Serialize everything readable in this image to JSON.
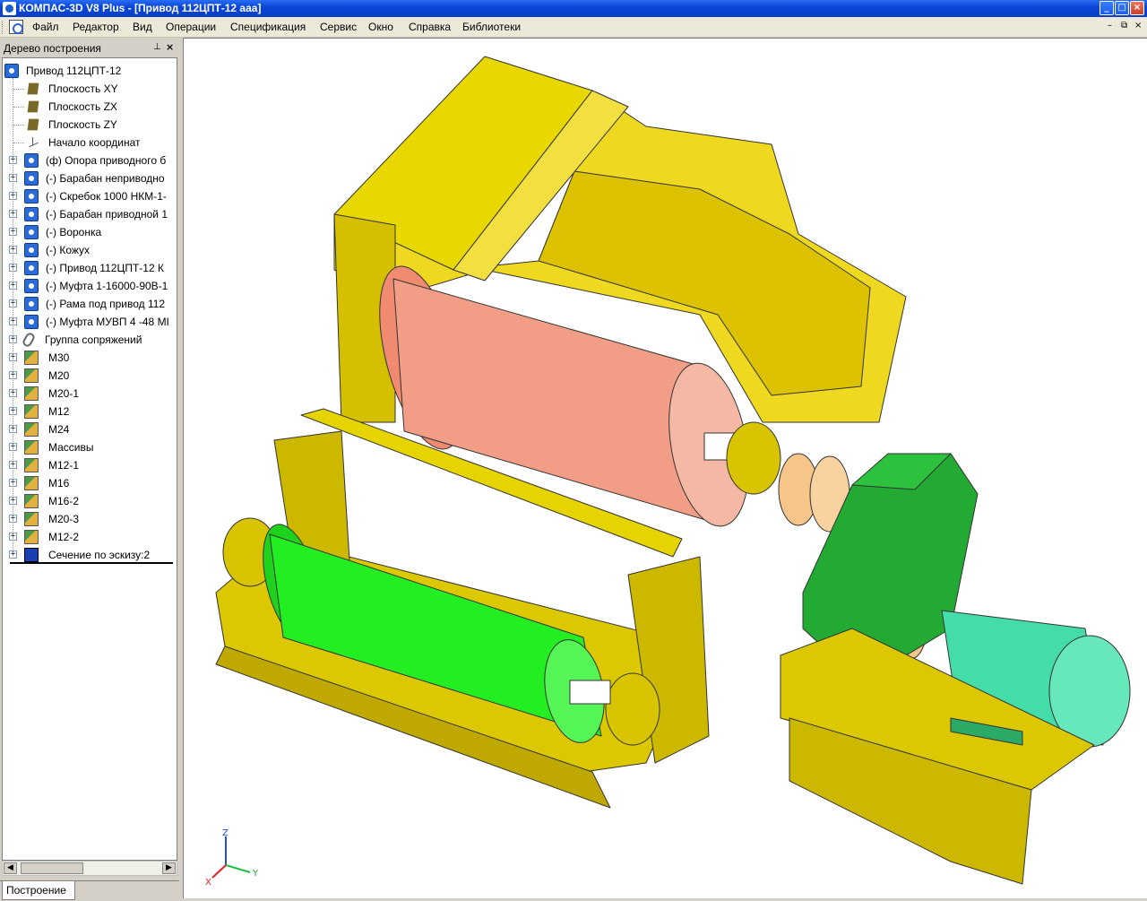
{
  "window": {
    "title": "КОМПАС-3D V8 Plus - [Привод 112ЦПТ-12 ааа]"
  },
  "menu": [
    "Файл",
    "Редактор",
    "Вид",
    "Операции",
    "Спецификация",
    "Сервис",
    "Окно",
    "Справка",
    "Библиотеки"
  ],
  "tree_panel": {
    "caption": "Дерево построения",
    "pin_glyph": "ᵖ",
    "close_glyph": "×",
    "root": "Привод 112ЦПТ-12",
    "items": [
      {
        "label": "Плоскость XY",
        "icon": "plane-icon",
        "expander": false
      },
      {
        "label": "Плоскость ZX",
        "icon": "plane-icon",
        "expander": false
      },
      {
        "label": "Плоскость ZY",
        "icon": "plane-icon",
        "expander": false
      },
      {
        "label": "Начало координат",
        "icon": "origin-icon",
        "expander": false
      },
      {
        "label": "(ф) Опора приводного б",
        "icon": "part-icon",
        "expander": true
      },
      {
        "label": "(-) Барабан неприводно",
        "icon": "part-icon",
        "expander": true
      },
      {
        "label": "(-) Скребок 1000 НКМ-1-",
        "icon": "part-icon",
        "expander": true
      },
      {
        "label": "(-) Барабан приводной 1",
        "icon": "part-icon",
        "expander": true
      },
      {
        "label": "(-) Воронка",
        "icon": "part-icon",
        "expander": true
      },
      {
        "label": "(-) Кожух",
        "icon": "part-icon",
        "expander": true
      },
      {
        "label": "(-) Привод 112ЦПТ-12 К",
        "icon": "part-icon",
        "expander": true
      },
      {
        "label": "(-) Муфта 1-16000-90В-1",
        "icon": "part-icon",
        "expander": true
      },
      {
        "label": "(-) Рама под привод 112",
        "icon": "part-icon",
        "expander": true
      },
      {
        "label": "(-) Муфта МУВП 4 -48 МІ",
        "icon": "part-icon",
        "expander": true
      },
      {
        "label": "Группа сопряжений",
        "icon": "mate-icon",
        "expander": true
      },
      {
        "label": "М30",
        "icon": "array-icon",
        "expander": true
      },
      {
        "label": "М20",
        "icon": "array-icon",
        "expander": true
      },
      {
        "label": "М20-1",
        "icon": "array-icon",
        "expander": true
      },
      {
        "label": "М12",
        "icon": "array-icon",
        "expander": true
      },
      {
        "label": "М24",
        "icon": "array-icon",
        "expander": true
      },
      {
        "label": "Массивы",
        "icon": "array-icon",
        "expander": true
      },
      {
        "label": "М12-1",
        "icon": "array-icon",
        "expander": true
      },
      {
        "label": "М16",
        "icon": "array-icon",
        "expander": true
      },
      {
        "label": "М16-2",
        "icon": "array-icon",
        "expander": true
      },
      {
        "label": "М20-3",
        "icon": "array-icon",
        "expander": true
      },
      {
        "label": "М12-2",
        "icon": "array-icon",
        "expander": true
      },
      {
        "label": "Сечение по эскизу:2",
        "icon": "section-icon",
        "expander": true
      }
    ]
  },
  "bottom_tab": "Построение",
  "triad": {
    "x": "X",
    "y": "Y",
    "z": "Z"
  },
  "colors": {
    "frame": "#e8d200",
    "pulley_drive": "#f0927a",
    "pulley_tail": "#22ee22",
    "gearbox": "#22aa33",
    "motor": "#44ddaa",
    "coupling": "#f5c58a"
  }
}
